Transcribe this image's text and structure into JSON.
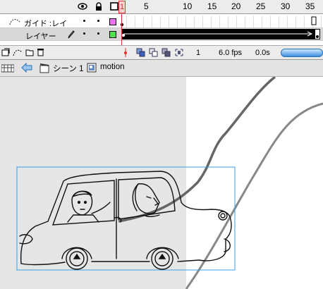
{
  "timeline": {
    "frame_numbers": [
      "1",
      "5",
      "10",
      "15",
      "20",
      "25",
      "30",
      "35"
    ],
    "current_frame_marker": "1",
    "layers": [
      {
        "name": "ガイド :レイ",
        "type": "guide",
        "color": "#f070f0"
      },
      {
        "name": "レイヤー",
        "type": "normal",
        "color": "#50e050"
      }
    ],
    "footer": {
      "current_frame": "1",
      "frame_rate": "6.0 fps",
      "elapsed_time": "0.0s"
    }
  },
  "editbar": {
    "scene_label": "シーン 1",
    "symbol_label": "motion"
  },
  "colors": {
    "accent": "#e03030",
    "selection_box": "#3aa0e0",
    "guide_path": "#777777"
  }
}
